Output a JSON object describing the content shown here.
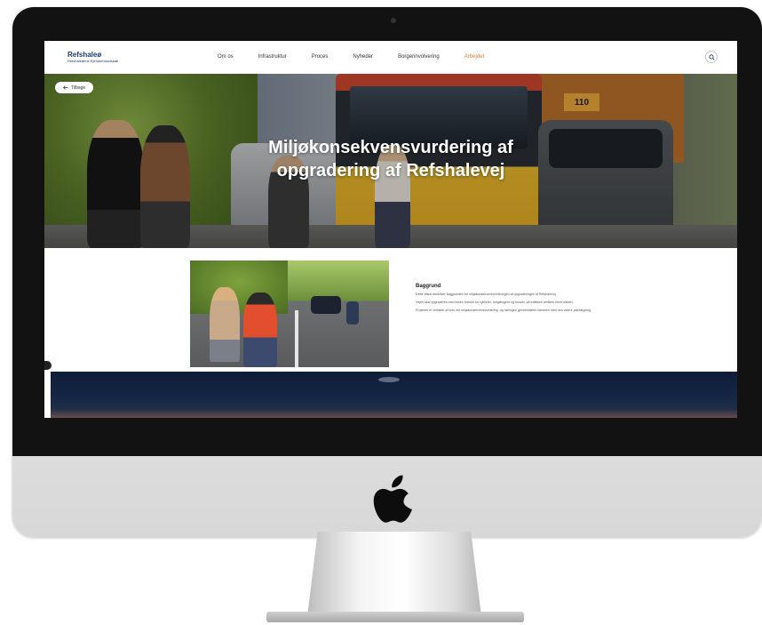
{
  "site": {
    "logo_name": "Refshaleø",
    "logo_sub": "Refshaleøens Ejendomsselskab"
  },
  "nav": {
    "items": [
      {
        "label": "Om os",
        "active": false
      },
      {
        "label": "Infrastruktur",
        "active": false
      },
      {
        "label": "Proces",
        "active": false
      },
      {
        "label": "Nyheder",
        "active": false
      },
      {
        "label": "Borgerinvolvering",
        "active": false
      },
      {
        "label": "Arbejdet",
        "active": true
      }
    ]
  },
  "hero": {
    "back_label": "Tilbage",
    "title_line1": "Miljøkonsekvensvurdering af",
    "title_line2": "opgradering af Refshalevej",
    "truck_number": "110"
  },
  "article": {
    "heading": "Baggrund",
    "paragraphs": [
      "Dette afsnit beskriver baggrunden for miljøkonsekvensvurderingen af opgraderingen af Refshalevej.",
      "Vejen skal opgraderes med bedre forhold for cyklister, fodgængere og busser, så trafikken afvikles mere sikkert.",
      "Projektet er omfattet af krav om miljøkonsekvensvurdering, og høringen gennemføres sammen med den videre planlægning."
    ]
  },
  "colors": {
    "brand_navy": "#1f3a6e",
    "accent_orange": "#e07a2e"
  },
  "icons": [
    "search-icon",
    "arrow-left-icon",
    "apple-logo-icon"
  ]
}
